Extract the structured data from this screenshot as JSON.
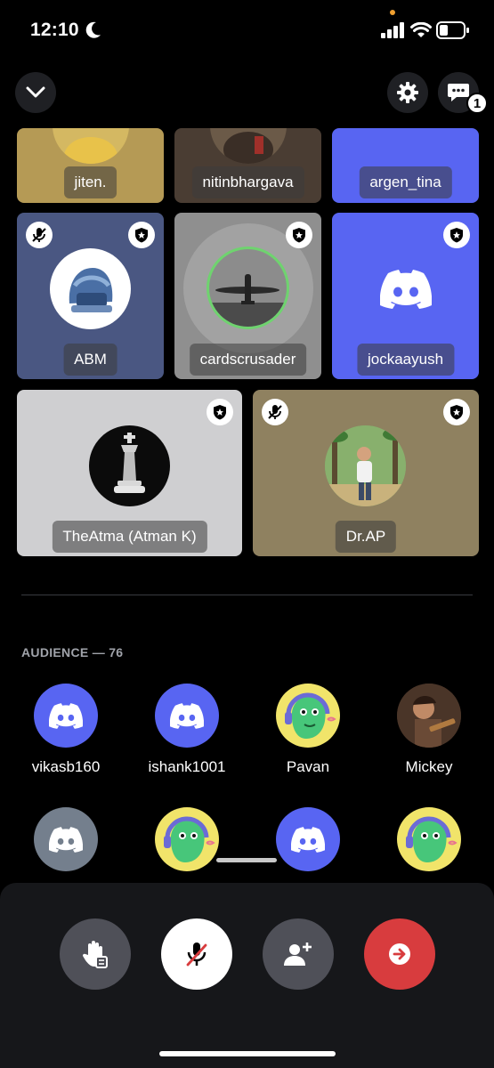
{
  "status_bar": {
    "time": "12:10"
  },
  "top_bar": {
    "chat_badge_count": "1"
  },
  "speakers_row1": [
    {
      "name": "jiten."
    },
    {
      "name": "nitinbhargava"
    },
    {
      "name": "argen_tina"
    }
  ],
  "speakers_row2": [
    {
      "name": "ABM"
    },
    {
      "name": "cardscrusader"
    },
    {
      "name": "jockaayush"
    }
  ],
  "speakers_row3": [
    {
      "name": "TheAtma (Atman K)"
    },
    {
      "name": "Dr.AP"
    }
  ],
  "audience": {
    "header": "AUDIENCE — 76",
    "row1": [
      {
        "name": "vikasb160",
        "avatar": "discord-blurple"
      },
      {
        "name": "ishank1001",
        "avatar": "discord-blurple"
      },
      {
        "name": "Pavan",
        "avatar": "cartoon-headset"
      },
      {
        "name": "Mickey",
        "avatar": "photo"
      }
    ],
    "row2": [
      {
        "avatar": "discord-grey"
      },
      {
        "avatar": "cartoon-headset"
      },
      {
        "avatar": "discord-blurple"
      },
      {
        "avatar": "cartoon-headset"
      }
    ]
  },
  "colors": {
    "blurple": "#5865f2",
    "tile_blue": "#4a5782",
    "tile_grey": "#cfcfd1",
    "tile_khaki": "#8f8160",
    "leave_red": "#d83c3e"
  }
}
